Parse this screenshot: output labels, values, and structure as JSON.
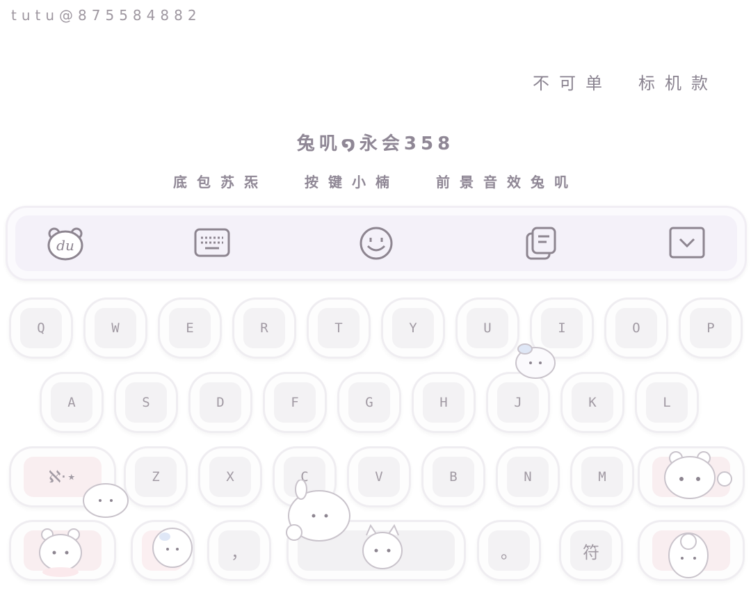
{
  "watermark": "tutu@875584882",
  "header": {
    "label": "不可单　标机款"
  },
  "title": "兔叽໑永会358",
  "subtitle": {
    "part1": "底包苏炁",
    "part2": "按键小楠",
    "part3": "前景音效兔叽"
  },
  "toolbar": {
    "icons": [
      "du-bear-logo-icon",
      "keyboard-icon",
      "emoji-smile-icon",
      "clipboard-icon",
      "collapse-chevron-icon"
    ]
  },
  "keyboard": {
    "row1": [
      "Q",
      "W",
      "E",
      "R",
      "T",
      "Y",
      "U",
      "I",
      "O",
      "P"
    ],
    "row2": [
      "A",
      "S",
      "D",
      "F",
      "G",
      "H",
      "J",
      "K",
      "L"
    ],
    "row3": [
      "Z",
      "X",
      "C",
      "V",
      "B",
      "N",
      "M"
    ],
    "shift_label": "ℵ·⋆",
    "comma": "，",
    "period": "。",
    "symbols": "符"
  },
  "colors": {
    "accent": "#8e8690",
    "key_fill": "#f3f2f4",
    "pink_key": "#fbeff1",
    "toolbar_bg": "#f4f1f9"
  }
}
